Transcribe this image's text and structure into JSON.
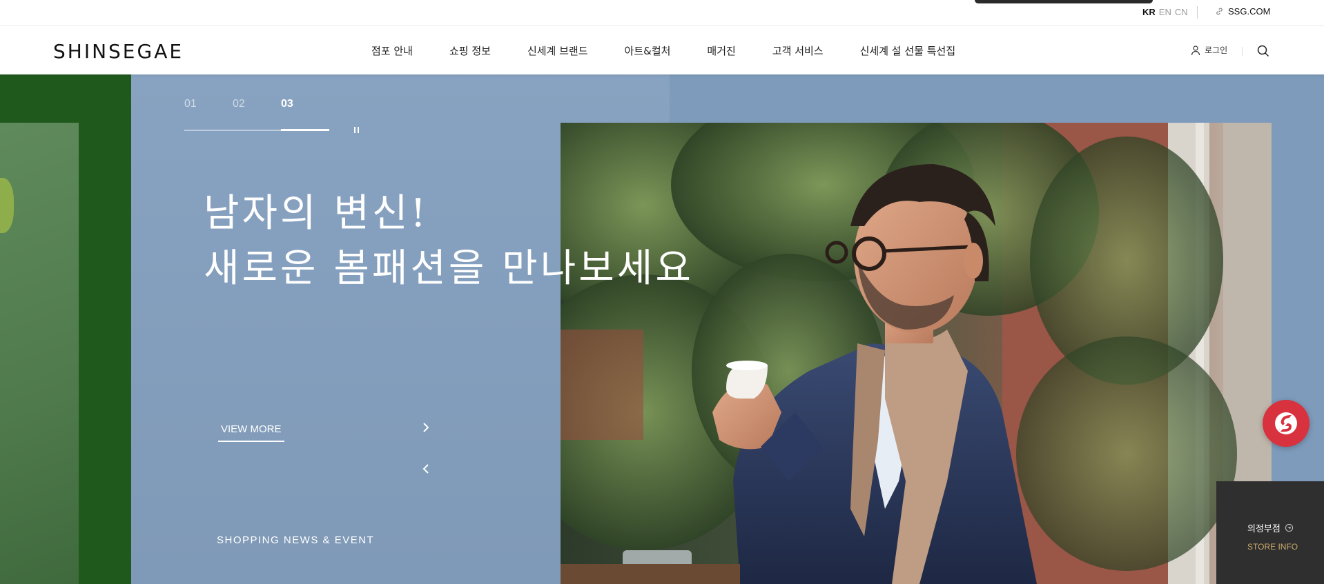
{
  "topbar": {
    "languages": [
      {
        "label": "KR",
        "active": true
      },
      {
        "label": "EN",
        "active": false
      },
      {
        "label": "CN",
        "active": false
      }
    ],
    "ssg_link": "SSG.COM"
  },
  "header": {
    "logo": "SHINSEGAE",
    "nav": [
      "점포 안내",
      "쇼핑 정보",
      "신세계 브랜드",
      "아트&컬처",
      "매거진",
      "고객 서비스",
      "신세계 설 선물 특선집"
    ],
    "login_label": "로그인",
    "icons": {
      "login": "user-icon",
      "search": "search-icon",
      "ssg": "link-icon"
    }
  },
  "hero": {
    "slides": [
      "01",
      "02",
      "03"
    ],
    "active_slide": 3,
    "title_line1": "남자의 변신!",
    "title_line2": "새로운 봄패션을 만나보세요",
    "view_more": "VIEW MORE",
    "section_label": "SHOPPING NEWS & EVENT",
    "image_subject": "man in navy suit drinking espresso outdoors",
    "colors": {
      "background": "#84a0bf",
      "prev_slide": "#1f5a1c"
    }
  },
  "store": {
    "name": "의정부점",
    "info_label": "STORE INFO",
    "accent": "#c8a96a"
  },
  "floating_button": {
    "icon": "ssg-logo-icon",
    "color": "#d8323e"
  }
}
